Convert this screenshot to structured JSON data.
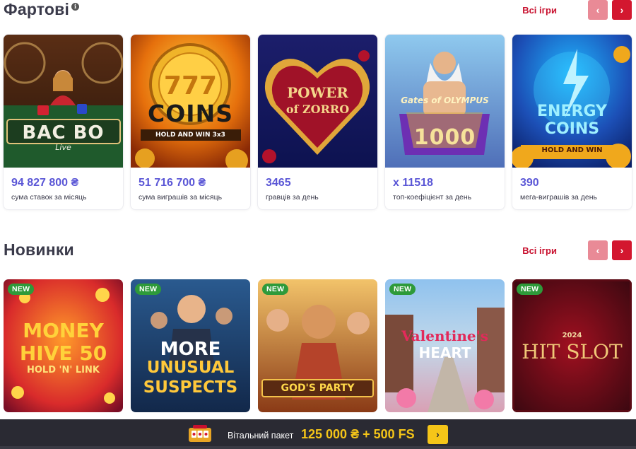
{
  "lucky": {
    "title": "Фартові",
    "info_icon": "i",
    "all_games": "Всі ігри",
    "prev_icon": "‹",
    "next_icon": "›",
    "cards": [
      {
        "game": "BAC BO",
        "game_sub": "Live",
        "value": "94 827 800 ₴",
        "caption": "сума ставок за місяць"
      },
      {
        "game": "COINS",
        "game_top": "777",
        "game_sub": "HOLD AND WIN 3x3",
        "value": "51 716 700 ₴",
        "caption": "сума виграшів за місяць"
      },
      {
        "game": "POWER",
        "game_top": "of ZORRO",
        "value": "3465",
        "caption": "гравців за день"
      },
      {
        "game": "Gates of OLYMPUS",
        "game_sub": "1000",
        "value": "x 11518",
        "caption": "топ-коефіцієнт за день"
      },
      {
        "game": "ENERGY COINS",
        "game_sub": "HOLD AND WIN",
        "value": "390",
        "caption": "мега-виграшів за день"
      }
    ]
  },
  "newest": {
    "title": "Новинки",
    "all_games": "Всі ігри",
    "prev_icon": "‹",
    "next_icon": "›",
    "badge": "NEW",
    "tiles": [
      {
        "line1": "MONEY",
        "line2": "HIVE 50",
        "line3": "HOLD 'N' LINK"
      },
      {
        "line1": "MORE",
        "line2": "UNUSUAL",
        "line3": "SUSPECTS"
      },
      {
        "line1": "GOD'S PARTY"
      },
      {
        "line1": "Valentine's",
        "line2": "HEART"
      },
      {
        "line1": "2024",
        "line2": "HIT SLOT"
      }
    ]
  },
  "promo": {
    "label": "Вітальний пакет",
    "amount": "125 000 ₴ + 500 FS",
    "button_icon": "›"
  },
  "colors": {
    "accent_red": "#d3172f",
    "value_purple": "#5a56d6",
    "promo_yellow": "#f5c518",
    "badge_green": "#2e9a3a"
  }
}
